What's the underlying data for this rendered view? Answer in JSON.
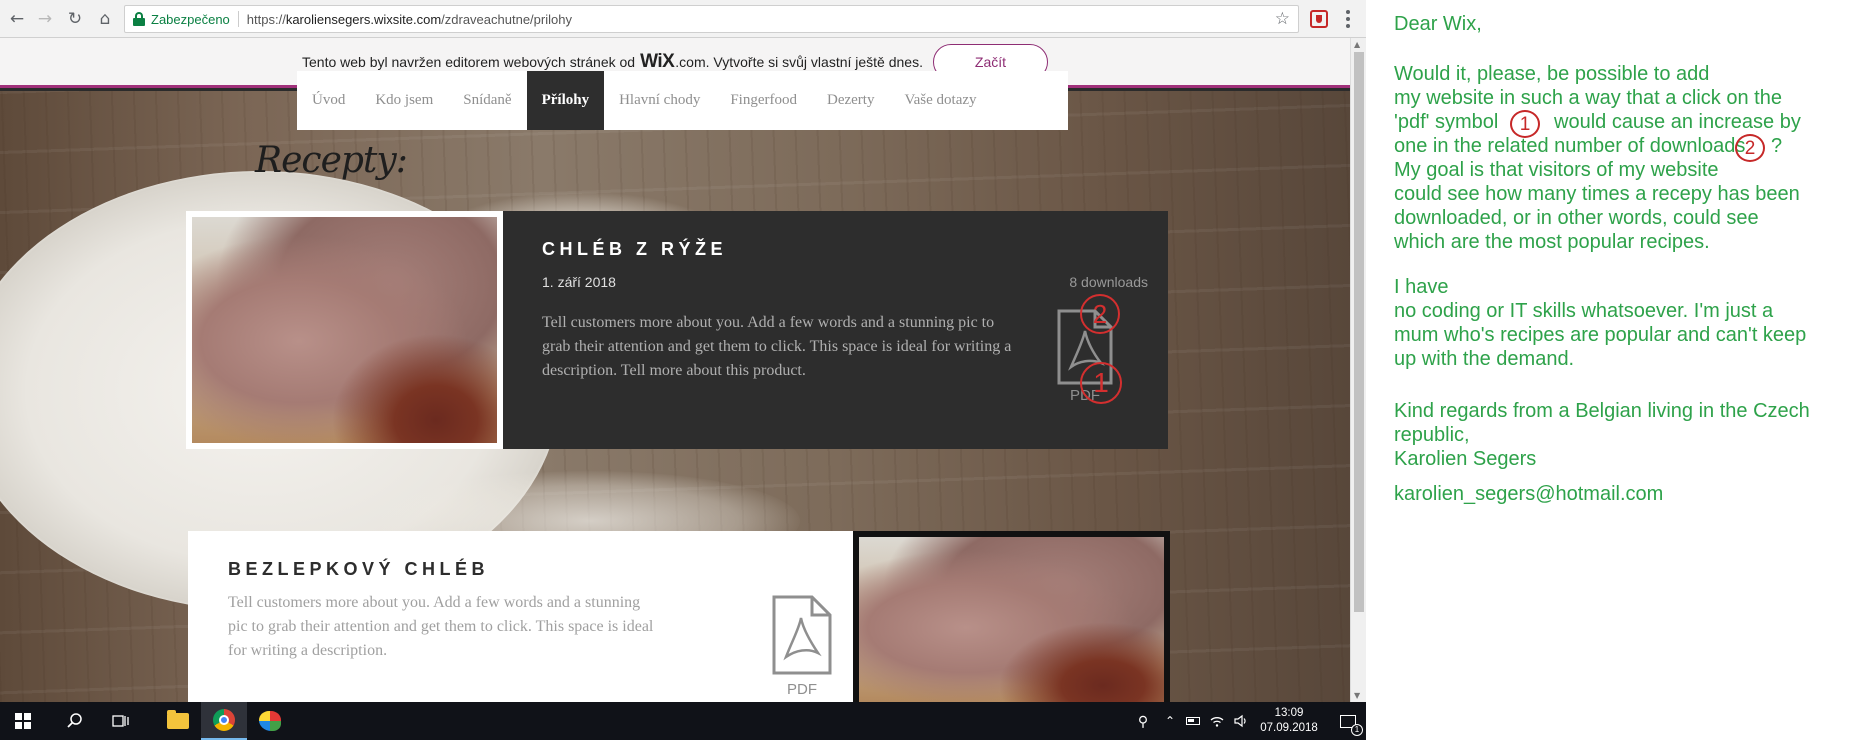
{
  "browser": {
    "secure_label": "Zabezpečeno",
    "url_scheme": "https://",
    "url_host": "karoliensegers.wixsite.com",
    "url_path": "/zdraveachutne/prilohy",
    "icons": {
      "back": "back-arrow-icon",
      "forward": "forward-arrow-icon",
      "reload": "reload-icon",
      "home": "home-icon",
      "star": "star-icon",
      "menu": "kebab-menu-icon"
    }
  },
  "wix_banner": {
    "text_before": "Tento web byl navržen editorem webových stránek od",
    "logo": "WiX",
    "logo_suffix": ".com. Vytvořte si svůj vlastní ještě dnes.",
    "button": "Začít"
  },
  "site": {
    "nav": [
      "Úvod",
      "Kdo jsem",
      "Snídaně",
      "Přílohy",
      "Hlavní chody",
      "Fingerfood",
      "Dezerty",
      "Vaše dotazy"
    ],
    "active_nav": "Přílohy",
    "heading": "Recepty:",
    "products": [
      {
        "title": "CHLÉB Z RÝŽE",
        "date": "1. září 2018",
        "description": "Tell customers more about you. Add a few words and a stunning pic to grab their attention and get them to click. This space is ideal for writing a description. Tell more about this product.",
        "downloads": "8 downloads",
        "file_label": "PDF"
      },
      {
        "title": "BEZLEPKOVÝ CHLÉB",
        "description": "Tell customers more about you. Add a few words and a stunning pic to grab their attention and get them to click. This space is ideal for writing a description.",
        "file_label": "PDF"
      }
    ],
    "annotation_markers": [
      "1",
      "2"
    ]
  },
  "taskbar": {
    "time": "13:09",
    "date": "07.09.2018",
    "notification_count": "1",
    "apps": [
      "file-explorer-icon",
      "chrome-icon",
      "paint-icon"
    ]
  },
  "letter": {
    "greeting": "Dear Wix,",
    "p1": [
      "Would it, please, be possible  to add",
      "my website in such a way that a click on the",
      "'pdf' symbol",
      "would cause an increase by",
      "one in the related number of downloads",
      "?",
      "My goal is that visitors of my website",
      "could see how many times a recepy has been",
      "downloaded, or in other words, could see",
      "which are the most popular recipes."
    ],
    "p2": [
      "I have",
      "no coding or IT skills whatsoever. I'm just a",
      "mum who's recipes are popular and can't keep",
      "up with the demand."
    ],
    "p3": [
      "Kind regards from a Belgian living in the Czech",
      "republic,",
      "Karolien Segers"
    ],
    "email": "karolien_segers@hotmail.com",
    "marker1": "1",
    "marker2": "2"
  }
}
